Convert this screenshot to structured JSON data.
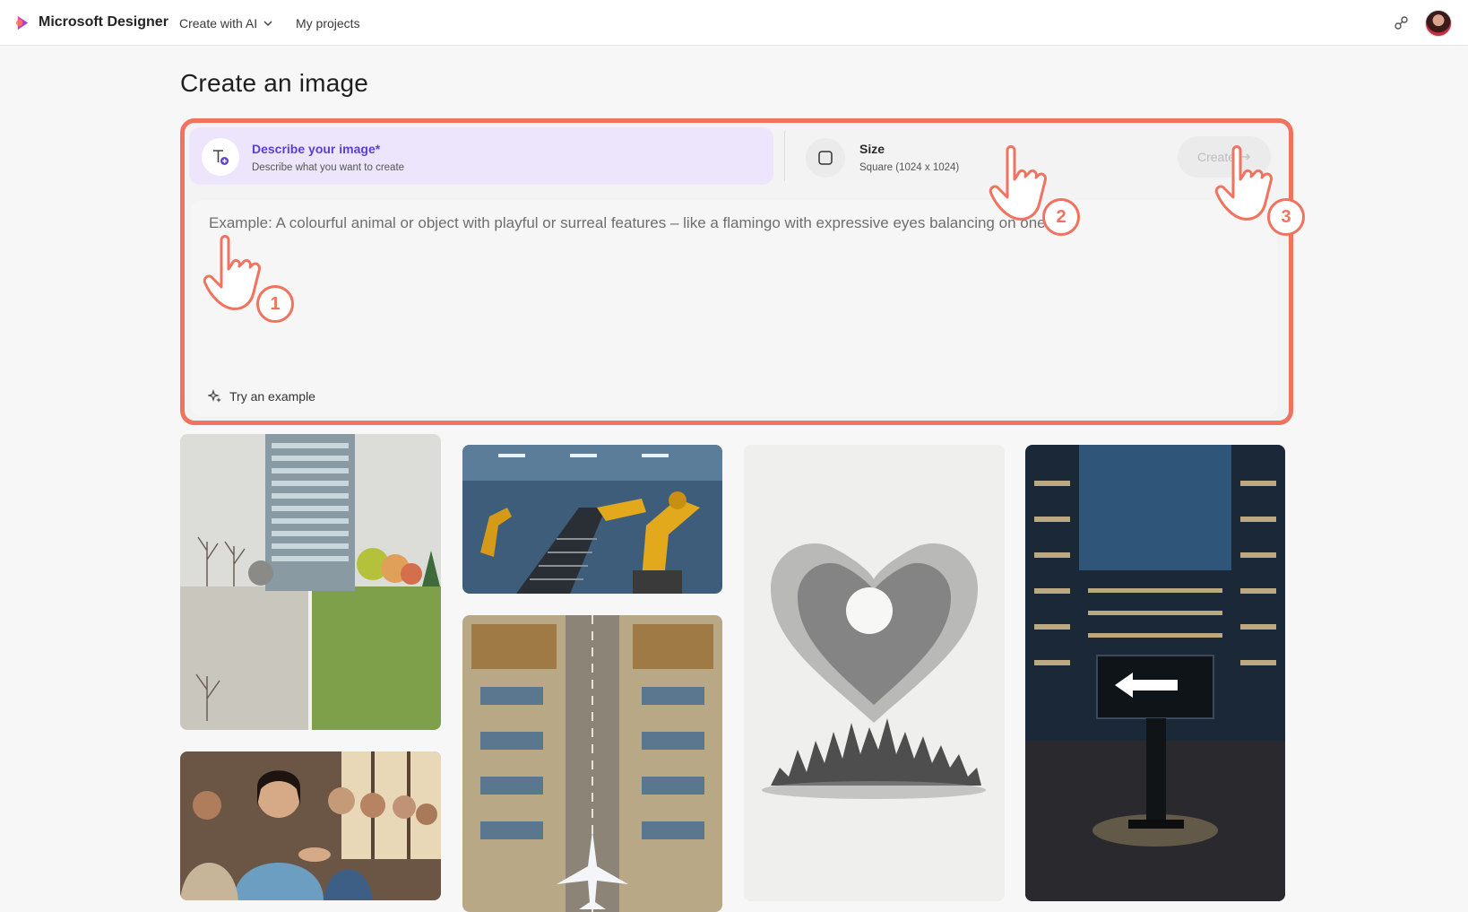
{
  "app": {
    "brand": "Microsoft Designer",
    "nav": {
      "create_with_ai": "Create with AI",
      "my_projects": "My projects"
    }
  },
  "page": {
    "title": "Create an image"
  },
  "panel": {
    "describe": {
      "title": "Describe your image*",
      "subtitle": "Describe what you want to create"
    },
    "size": {
      "title": "Size",
      "value": "Square (1024 x 1024)"
    },
    "create_label": "Create",
    "prompt_placeholder": "Example: A colourful animal or object with playful or surreal features – like a flamingo with expressive eyes balancing on one leg",
    "try_example": "Try an example"
  },
  "annotations": [
    "1",
    "2",
    "3"
  ],
  "colors": {
    "accent": "#5b3fd1",
    "highlight": "#f0735f"
  },
  "icons": {
    "logo": "designer-logo-icon",
    "text_add": "text-add-icon",
    "size": "square-icon",
    "create_arrow": "arrow-right-icon",
    "sparkle": "sparkle-icon",
    "share": "share-icon"
  }
}
